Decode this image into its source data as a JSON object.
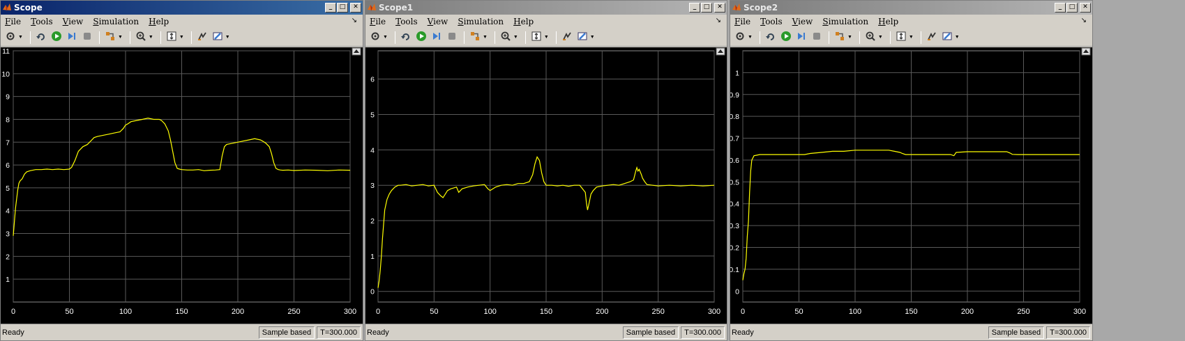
{
  "menu_labels": [
    {
      "key": "F",
      "rest": "ile"
    },
    {
      "key": "T",
      "rest": "ools"
    },
    {
      "key": "V",
      "rest": "iew"
    },
    {
      "key": "S",
      "rest": "imulation"
    },
    {
      "key": "H",
      "rest": "elp"
    }
  ],
  "colors": {
    "trace": "#ffff00",
    "grid": "#5a5a5a",
    "axis_text": "#ffffff",
    "plot_bg": "#000000"
  },
  "windows": [
    {
      "title": "Scope",
      "active": true,
      "status": {
        "ready": "Ready",
        "mode": "Sample based",
        "time": "T=300.000"
      },
      "chart_data": {
        "type": "line",
        "title": "",
        "xlabel": "",
        "ylabel": "",
        "xlim": [
          0,
          300
        ],
        "ylim": [
          0,
          11
        ],
        "xticks": [
          0,
          50,
          100,
          150,
          200,
          250,
          300
        ],
        "yticks": [
          1,
          2,
          3,
          4,
          5,
          6,
          7,
          8,
          9,
          10,
          11
        ],
        "grid": true,
        "x": [
          0,
          1,
          2,
          3,
          4,
          5,
          6,
          8,
          10,
          12,
          15,
          20,
          25,
          30,
          35,
          40,
          45,
          50,
          52,
          55,
          58,
          62,
          66,
          70,
          72,
          75,
          80,
          85,
          90,
          95,
          98,
          100,
          102,
          105,
          110,
          115,
          120,
          125,
          130,
          132,
          135,
          138,
          140,
          142,
          144,
          146,
          148,
          150,
          155,
          160,
          165,
          170,
          175,
          180,
          184,
          186,
          188,
          190,
          195,
          200,
          205,
          210,
          215,
          220,
          222,
          225,
          228,
          230,
          232,
          234,
          236,
          238,
          240,
          245,
          250,
          260,
          270,
          280,
          290,
          300
        ],
        "y": [
          2.9,
          3.5,
          4.1,
          4.5,
          4.9,
          5.2,
          5.3,
          5.4,
          5.6,
          5.7,
          5.75,
          5.8,
          5.8,
          5.82,
          5.8,
          5.82,
          5.8,
          5.82,
          5.9,
          6.2,
          6.6,
          6.8,
          6.9,
          7.1,
          7.2,
          7.25,
          7.3,
          7.35,
          7.4,
          7.45,
          7.6,
          7.75,
          7.8,
          7.9,
          7.95,
          8.0,
          8.05,
          8.0,
          8.0,
          7.95,
          7.8,
          7.5,
          7.1,
          6.6,
          6.1,
          5.85,
          5.82,
          5.8,
          5.78,
          5.78,
          5.8,
          5.75,
          5.77,
          5.78,
          5.8,
          6.4,
          6.8,
          6.9,
          6.95,
          7.0,
          7.05,
          7.1,
          7.15,
          7.1,
          7.05,
          6.95,
          6.8,
          6.5,
          6.1,
          5.85,
          5.8,
          5.78,
          5.77,
          5.78,
          5.76,
          5.78,
          5.77,
          5.75,
          5.78,
          5.77
        ]
      }
    },
    {
      "title": "Scope1",
      "active": false,
      "status": {
        "ready": "Ready",
        "mode": "Sample based",
        "time": "T=300.000"
      },
      "chart_data": {
        "type": "line",
        "title": "",
        "xlabel": "",
        "ylabel": "",
        "xlim": [
          0,
          300
        ],
        "ylim": [
          -0.3,
          6.8
        ],
        "xticks": [
          0,
          50,
          100,
          150,
          200,
          250,
          300
        ],
        "yticks": [
          0,
          1,
          2,
          3,
          4,
          5,
          6
        ],
        "grid": true,
        "x": [
          0,
          1,
          2,
          3,
          4,
          5,
          6,
          7,
          8,
          10,
          12,
          15,
          18,
          20,
          25,
          30,
          35,
          40,
          45,
          50,
          53,
          56,
          58,
          60,
          62,
          65,
          70,
          72,
          75,
          80,
          85,
          90,
          95,
          98,
          100,
          105,
          110,
          115,
          120,
          125,
          130,
          135,
          138,
          140,
          142,
          144,
          146,
          148,
          150,
          155,
          160,
          165,
          170,
          175,
          180,
          185,
          186,
          187,
          188,
          189,
          190,
          192,
          195,
          200,
          205,
          210,
          215,
          220,
          225,
          228,
          230,
          231,
          232,
          233,
          235,
          236,
          238,
          240,
          245,
          250,
          260,
          270,
          280,
          290,
          300
        ],
        "y": [
          0.1,
          0.3,
          0.6,
          1.0,
          1.5,
          1.9,
          2.3,
          2.45,
          2.6,
          2.75,
          2.85,
          2.95,
          3.0,
          3.0,
          3.02,
          2.98,
          3.0,
          3.02,
          2.98,
          3.0,
          2.8,
          2.7,
          2.65,
          2.75,
          2.85,
          2.9,
          2.95,
          2.8,
          2.9,
          2.95,
          2.98,
          3.0,
          3.02,
          2.9,
          2.85,
          2.95,
          3.0,
          3.02,
          3.0,
          3.05,
          3.05,
          3.1,
          3.3,
          3.6,
          3.8,
          3.7,
          3.35,
          3.1,
          3.0,
          3.0,
          2.98,
          3.0,
          2.97,
          3.0,
          3.0,
          2.8,
          2.5,
          2.3,
          2.45,
          2.6,
          2.75,
          2.85,
          2.95,
          2.98,
          3.0,
          3.02,
          3.0,
          3.05,
          3.1,
          3.15,
          3.4,
          3.5,
          3.4,
          3.45,
          3.3,
          3.2,
          3.1,
          3.02,
          3.0,
          2.98,
          3.0,
          2.98,
          3.0,
          2.98,
          3.0
        ]
      }
    },
    {
      "title": "Scope2",
      "active": false,
      "status": {
        "ready": "Ready",
        "mode": "Sample based",
        "time": "T=300.000"
      },
      "chart_data": {
        "type": "line",
        "title": "",
        "xlabel": "",
        "ylabel": "",
        "xlim": [
          0,
          300
        ],
        "ylim": [
          -0.05,
          1.1
        ],
        "xticks": [
          0,
          50,
          100,
          150,
          200,
          250,
          300
        ],
        "yticks": [
          0,
          0.1,
          0.2,
          0.3,
          0.4,
          0.5,
          0.6,
          0.7,
          0.8,
          0.9,
          1
        ],
        "grid": true,
        "x": [
          0,
          1,
          2,
          3,
          4,
          5,
          6,
          7,
          8,
          10,
          12,
          15,
          20,
          30,
          40,
          50,
          55,
          60,
          70,
          80,
          90,
          100,
          110,
          120,
          130,
          135,
          140,
          142,
          145,
          150,
          160,
          170,
          180,
          185,
          188,
          190,
          200,
          210,
          220,
          230,
          235,
          238,
          240,
          245,
          250,
          260,
          270,
          280,
          290,
          300
        ],
        "y": [
          0.05,
          0.08,
          0.1,
          0.15,
          0.25,
          0.32,
          0.45,
          0.55,
          0.6,
          0.62,
          0.622,
          0.625,
          0.625,
          0.625,
          0.625,
          0.625,
          0.625,
          0.63,
          0.635,
          0.64,
          0.64,
          0.645,
          0.645,
          0.645,
          0.645,
          0.64,
          0.635,
          0.63,
          0.625,
          0.625,
          0.625,
          0.625,
          0.625,
          0.625,
          0.62,
          0.635,
          0.638,
          0.638,
          0.638,
          0.638,
          0.638,
          0.632,
          0.626,
          0.625,
          0.625,
          0.625,
          0.625,
          0.625,
          0.625,
          0.625
        ]
      }
    }
  ]
}
